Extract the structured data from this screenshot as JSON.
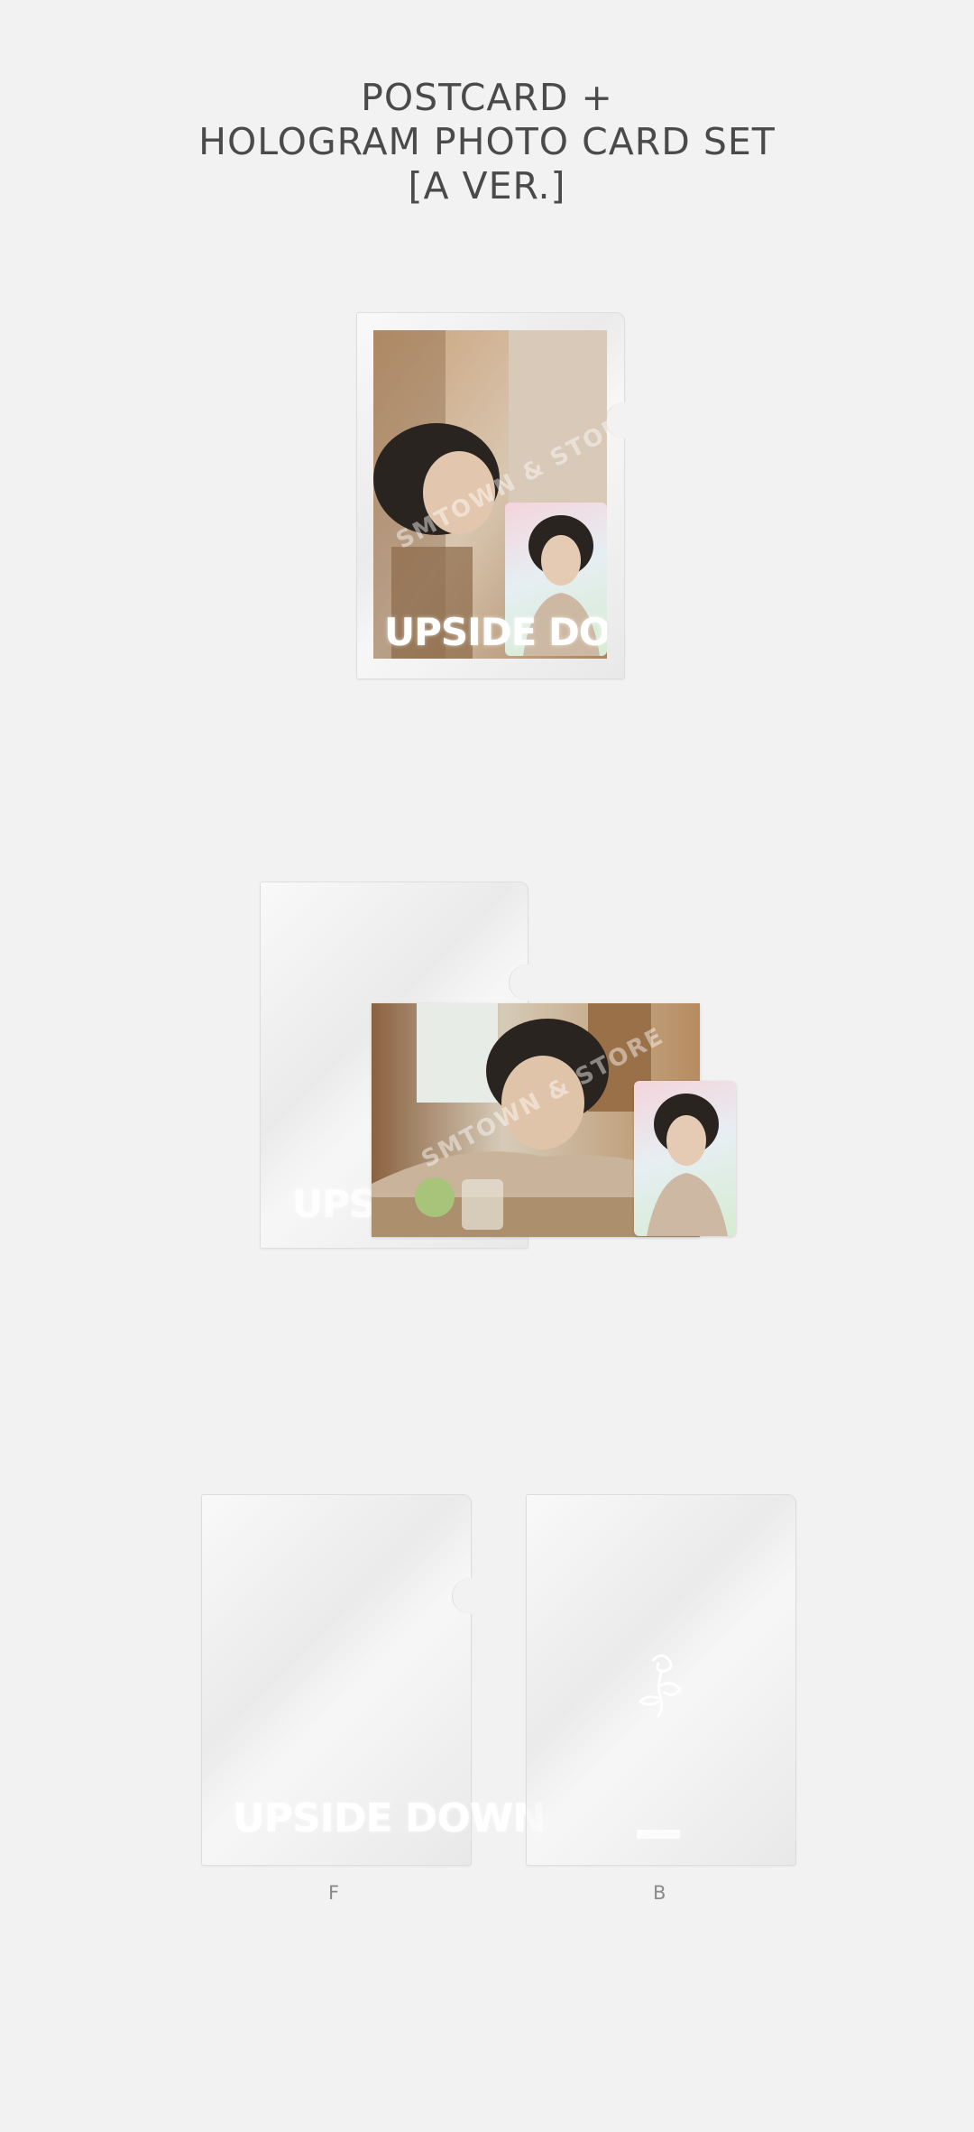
{
  "title": {
    "line1": "POSTCARD +",
    "line2": "HOLOGRAM PHOTO CARD SET",
    "line3": "[A VER.]"
  },
  "product": {
    "logo_text": "UPSIDE DOWN",
    "watermark": "SMTOWN & STORE"
  },
  "views": {
    "front_label": "F",
    "back_label": "B"
  },
  "colors": {
    "background": "#f2f2f2",
    "title": "#4a4a4a",
    "label": "#8a8a8a"
  }
}
